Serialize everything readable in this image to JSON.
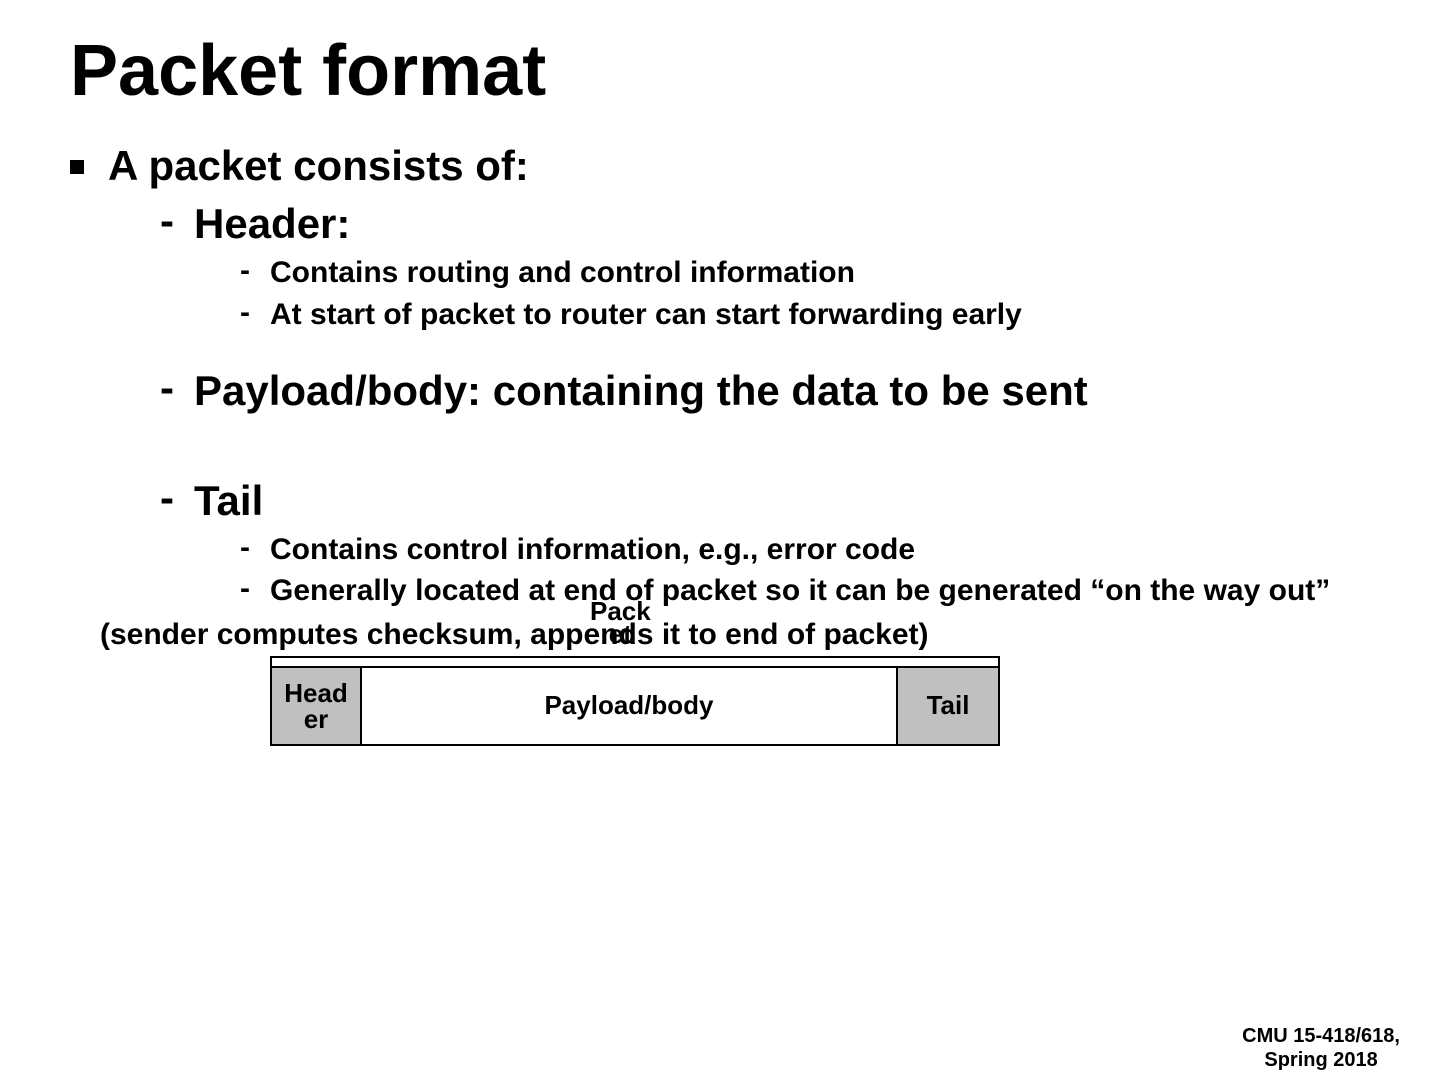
{
  "title": "Packet format",
  "bullets": {
    "main": "A packet consists of:",
    "header": "Header:",
    "header_sub1": "Contains routing and control information",
    "header_sub2": "At start of packet to router can start forwarding early",
    "payload": "Payload/body: containing the data to be sent",
    "tail": "Tail",
    "tail_sub1": "Contains control information, e.g., error code",
    "tail_sub2": "Generally located at end of packet so it can be generated “on the way out”"
  },
  "note": "(sender computes checksum, appends it to end of packet)",
  "overlay": "Pack\net",
  "diagram": {
    "header": "Head\ner",
    "payload": "Payload/body",
    "tail": "Tail"
  },
  "footer": {
    "line1": "CMU 15-418/618,",
    "line2": "Spring 2018"
  }
}
